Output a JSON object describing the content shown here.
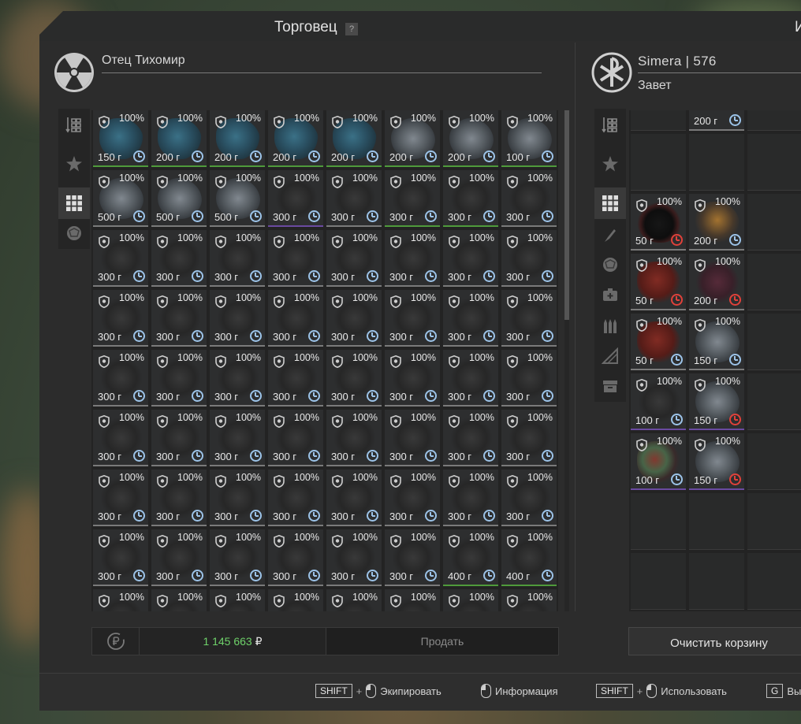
{
  "window": {
    "title": "Торговец",
    "help_label": "?",
    "right_title": "И"
  },
  "trader": {
    "name": "Отец Тихомир",
    "logo_icon": "radiation-icon"
  },
  "player": {
    "name": "Simera | 576",
    "faction": "Завет",
    "logo_icon": "faction-emblem-icon"
  },
  "trader_sidebar": [
    {
      "icon": "sort-icon",
      "active": false
    },
    {
      "icon": "star-artifact-icon",
      "active": false
    },
    {
      "icon": "grid-icon",
      "active": true
    },
    {
      "icon": "artifact-orb-icon",
      "active": false
    }
  ],
  "player_sidebar": [
    {
      "icon": "sort-icon",
      "active": false
    },
    {
      "icon": "star-artifact-icon",
      "active": false
    },
    {
      "icon": "grid-icon",
      "active": true
    },
    {
      "icon": "knife-icon",
      "active": false
    },
    {
      "icon": "artifact-orb-icon",
      "active": false
    },
    {
      "icon": "medkit-icon",
      "active": false
    },
    {
      "icon": "ammo-icon",
      "active": false
    },
    {
      "icon": "ruler-icon",
      "active": false
    },
    {
      "icon": "box-icon",
      "active": false
    }
  ],
  "trader_items": {
    "percent": "100%",
    "rows": [
      [
        [
          "150 г",
          "blue",
          "g"
        ],
        [
          "200 г",
          "blue",
          "g"
        ],
        [
          "200 г",
          "blue",
          "g"
        ],
        [
          "200 г",
          "blue",
          "g"
        ],
        [
          "200 г",
          "blue",
          "g"
        ],
        [
          "200 г",
          "sil",
          "g"
        ],
        [
          "200 г",
          "sil",
          "g"
        ],
        [
          "100 г",
          "sil",
          "g"
        ]
      ],
      [
        [
          "500 г",
          "sil",
          "w"
        ],
        [
          "500 г",
          "sil",
          "w"
        ],
        [
          "500 г",
          "sil",
          "w"
        ],
        [
          "300 г",
          "dark",
          "p"
        ],
        [
          "300 г",
          "dark",
          "w"
        ],
        [
          "300 г",
          "dark",
          "g"
        ],
        [
          "300 г",
          "dark",
          "g"
        ],
        [
          "300 г",
          "dark",
          "w"
        ]
      ],
      [
        [
          "300 г",
          "dark",
          "w"
        ],
        [
          "300 г",
          "dark",
          "w"
        ],
        [
          "300 г",
          "dark",
          "w"
        ],
        [
          "300 г",
          "dark",
          "w"
        ],
        [
          "300 г",
          "dark",
          "w"
        ],
        [
          "300 г",
          "dark",
          "w"
        ],
        [
          "300 г",
          "dark",
          "w"
        ],
        [
          "300 г",
          "dark",
          "w"
        ]
      ],
      [
        [
          "300 г",
          "dark",
          "w"
        ],
        [
          "300 г",
          "dark",
          "w"
        ],
        [
          "300 г",
          "dark",
          "w"
        ],
        [
          "300 г",
          "dark",
          "w"
        ],
        [
          "300 г",
          "dark",
          "w"
        ],
        [
          "300 г",
          "dark",
          "w"
        ],
        [
          "300 г",
          "dark",
          "w"
        ],
        [
          "300 г",
          "dark",
          "w"
        ]
      ],
      [
        [
          "300 г",
          "dark",
          "w"
        ],
        [
          "300 г",
          "dark",
          "w"
        ],
        [
          "300 г",
          "dark",
          "w"
        ],
        [
          "300 г",
          "dark",
          "w"
        ],
        [
          "300 г",
          "dark",
          "w"
        ],
        [
          "300 г",
          "dark",
          "w"
        ],
        [
          "300 г",
          "dark",
          "w"
        ],
        [
          "300 г",
          "dark",
          "w"
        ]
      ],
      [
        [
          "300 г",
          "dark",
          "w"
        ],
        [
          "300 г",
          "dark",
          "w"
        ],
        [
          "300 г",
          "dark",
          "w"
        ],
        [
          "300 г",
          "dark",
          "w"
        ],
        [
          "300 г",
          "dark",
          "w"
        ],
        [
          "300 г",
          "dark",
          "w"
        ],
        [
          "300 г",
          "dark",
          "w"
        ],
        [
          "300 г",
          "dark",
          "w"
        ]
      ],
      [
        [
          "300 г",
          "dark",
          "w"
        ],
        [
          "300 г",
          "dark",
          "w"
        ],
        [
          "300 г",
          "dark",
          "w"
        ],
        [
          "300 г",
          "dark",
          "w"
        ],
        [
          "300 г",
          "dark",
          "w"
        ],
        [
          "300 г",
          "dark",
          "w"
        ],
        [
          "300 г",
          "dark",
          "w"
        ],
        [
          "300 г",
          "dark",
          "w"
        ]
      ],
      [
        [
          "300 г",
          "dark",
          "w"
        ],
        [
          "300 г",
          "dark",
          "w"
        ],
        [
          "300 г",
          "dark",
          "w"
        ],
        [
          "300 г",
          "dark",
          "w"
        ],
        [
          "300 г",
          "dark",
          "w"
        ],
        [
          "300 г",
          "dark",
          "w"
        ],
        [
          "400 г",
          "dark",
          "g"
        ],
        [
          "400 г",
          "dark",
          "g"
        ]
      ],
      [
        [
          "",
          "dark",
          "w"
        ],
        [
          "",
          "dark",
          "w"
        ],
        [
          "",
          "dark",
          "w"
        ],
        [
          "",
          "dark",
          "w"
        ],
        [
          "",
          "dark",
          "w"
        ],
        [
          "",
          "dark",
          "w"
        ],
        [
          "",
          "dark",
          "w"
        ],
        [
          "",
          "dark",
          "w"
        ]
      ]
    ]
  },
  "player_items": {
    "percent": "100%",
    "cells": [
      {
        "col": 1,
        "row": 0,
        "price": "200 г",
        "art": "redtop",
        "border": "w",
        "clock": "blue",
        "partial": true
      },
      {
        "col": 0,
        "row": 2,
        "price": "50 г",
        "art": "black",
        "border": "w",
        "clock": "red"
      },
      {
        "col": 1,
        "row": 2,
        "price": "200 г",
        "art": "orange",
        "border": "w",
        "clock": "blue"
      },
      {
        "col": 0,
        "row": 3,
        "price": "50 г",
        "art": "red",
        "border": "w",
        "clock": "red"
      },
      {
        "col": 1,
        "row": 3,
        "price": "200 г",
        "art": "maroon",
        "border": "w",
        "clock": "red"
      },
      {
        "col": 0,
        "row": 4,
        "price": "50 г",
        "art": "red",
        "border": "w",
        "clock": "blue"
      },
      {
        "col": 1,
        "row": 4,
        "price": "150 г",
        "art": "sil",
        "border": "w",
        "clock": "blue"
      },
      {
        "col": 0,
        "row": 5,
        "price": "100 г",
        "art": "dark",
        "border": "p",
        "clock": "blue"
      },
      {
        "col": 1,
        "row": 5,
        "price": "150 г",
        "art": "sil",
        "border": "p",
        "clock": "red"
      },
      {
        "col": 0,
        "row": 6,
        "price": "100 г",
        "art": "mixed",
        "border": "p",
        "clock": "blue"
      },
      {
        "col": 1,
        "row": 6,
        "price": "150 г",
        "art": "sil",
        "border": "p",
        "clock": "red"
      }
    ]
  },
  "footer": {
    "balance": "1 145 663",
    "currency": "₽",
    "sell_label": "Продать",
    "clear_cart_label": "Очистить корзину"
  },
  "hints": {
    "equip_key": "SHIFT",
    "equip_label": "Экипировать",
    "info_label": "Информация",
    "use_key": "SHIFT",
    "use_label": "Использовать",
    "drop_key": "G",
    "drop_label": "Вы"
  },
  "colors": {
    "balance_green": "#6fd26a",
    "clock_blue": "#9cc3e8",
    "clock_red": "#e0413a",
    "border_green": "#4f9a3b",
    "border_purple": "#6a4aa0"
  }
}
